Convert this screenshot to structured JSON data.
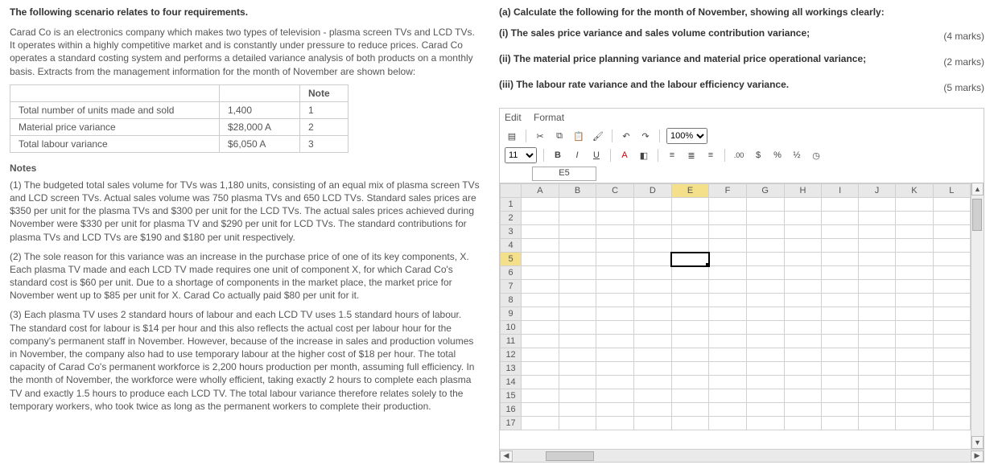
{
  "left": {
    "title": "The following scenario relates to four requirements.",
    "intro": "Carad Co is an electronics company which makes two types of television - plasma screen TVs and LCD TVs. It operates within a highly competitive market and is constantly under pressure to reduce prices. Carad Co operates a standard costing system and performs a detailed variance analysis of both products on a monthly basis. Extracts from the management information for the month of November are shown below:",
    "table": {
      "noteHeader": "Note",
      "rows": [
        {
          "label": "Total number of units made and sold",
          "val": "1,400",
          "note": "1"
        },
        {
          "label": "Material price variance",
          "val": "$28,000 A",
          "note": "2"
        },
        {
          "label": "Total labour variance",
          "val": "$6,050 A",
          "note": "3"
        }
      ]
    },
    "notesTitle": "Notes",
    "note1": "(1)  The budgeted total sales volume for TVs was 1,180 units, consisting of an equal mix of plasma screen TVs and LCD screen TVs. Actual sales volume was 750 plasma TVs and 650 LCD TVs. Standard sales prices are $350 per unit for the plasma TVs and $300 per unit for the LCD TVs. The actual sales prices achieved during November were $330 per unit for plasma TV and $290 per unit for LCD TVs. The standard contributions for plasma TVs and LCD TVs are $190 and $180 per unit respectively.",
    "note2": "(2)  The sole reason for this variance was an increase in the purchase price of one of its key components, X. Each plasma TV made and each LCD TV made requires one unit of component X, for which Carad Co's standard cost is $60 per unit. Due to a shortage of components in the market place, the market price for November went up to $85 per unit for X. Carad Co actually paid $80 per unit for it.",
    "note3": "(3)  Each plasma TV uses 2 standard hours of labour and each LCD TV uses 1.5 standard hours of labour. The standard cost for labour is $14 per hour and this also reflects the actual cost per labour hour for the company's permanent staff in November. However, because of the increase in sales and production volumes in November, the company also had to use temporary labour at the higher cost of $18 per hour.  The total capacity of Carad Co's permanent workforce is 2,200 hours production per month, assuming full efficiency. In the month of November, the workforce were wholly efficient, taking exactly 2 hours to complete each plasma TV and exactly 1.5 hours to produce each LCD TV. The total labour variance therefore relates solely to the temporary workers, who took twice as long as the permanent workers to complete their production."
  },
  "right": {
    "a_title": "(a) Calculate the following for the month of November, showing all workings clearly:",
    "i": "(i) The sales price variance and sales volume contribution variance;",
    "i_marks": "(4 marks)",
    "ii": "(ii) The material price planning variance and material price operational variance;",
    "ii_marks": "(2 marks)",
    "iii": "(iii) The labour rate variance and the labour efficiency variance.",
    "iii_marks": "(5 marks)"
  },
  "editor": {
    "menu": {
      "edit": "Edit",
      "format": "Format"
    },
    "zoom": "100%",
    "fontSize": "11",
    "nameBox": "E5",
    "cols": [
      "A",
      "B",
      "C",
      "D",
      "E",
      "F",
      "G",
      "H",
      "I",
      "J",
      "K",
      "L"
    ],
    "rows": 17,
    "selected": {
      "col": "E",
      "row": 5
    }
  }
}
